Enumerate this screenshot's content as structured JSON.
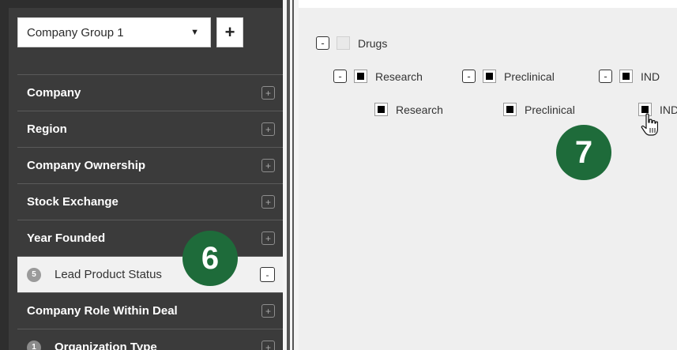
{
  "sidebar": {
    "group_select_value": "Company Group 1",
    "add_group_label": "+",
    "filters": [
      {
        "label": "Company",
        "badge": "",
        "toggle": "+"
      },
      {
        "label": "Region",
        "badge": "",
        "toggle": "+"
      },
      {
        "label": "Company Ownership",
        "badge": "",
        "toggle": "+"
      },
      {
        "label": "Stock Exchange",
        "badge": "",
        "toggle": "+"
      },
      {
        "label": "Year Founded",
        "badge": "",
        "toggle": "+"
      },
      {
        "label": "Lead Product Status",
        "badge": "5",
        "toggle": "-"
      },
      {
        "label": "Company Role Within Deal",
        "badge": "",
        "toggle": "+"
      },
      {
        "label": "Organization Type",
        "badge": "1",
        "toggle": "+"
      }
    ]
  },
  "tree": {
    "root": {
      "label": "Drugs",
      "toggle": "-"
    },
    "level1": [
      {
        "label": "Research",
        "toggle": "-"
      },
      {
        "label": "Preclinical",
        "toggle": "-"
      },
      {
        "label": "IND",
        "toggle": "-"
      }
    ],
    "level2": [
      {
        "label": "Research"
      },
      {
        "label": "Preclinical"
      },
      {
        "label": "IND"
      }
    ]
  },
  "step_badges": {
    "six": "6",
    "seven": "7"
  },
  "colors": {
    "step_badge": "#1e6b3a",
    "sidebar": "#3b3b3b",
    "main": "#efefef"
  }
}
